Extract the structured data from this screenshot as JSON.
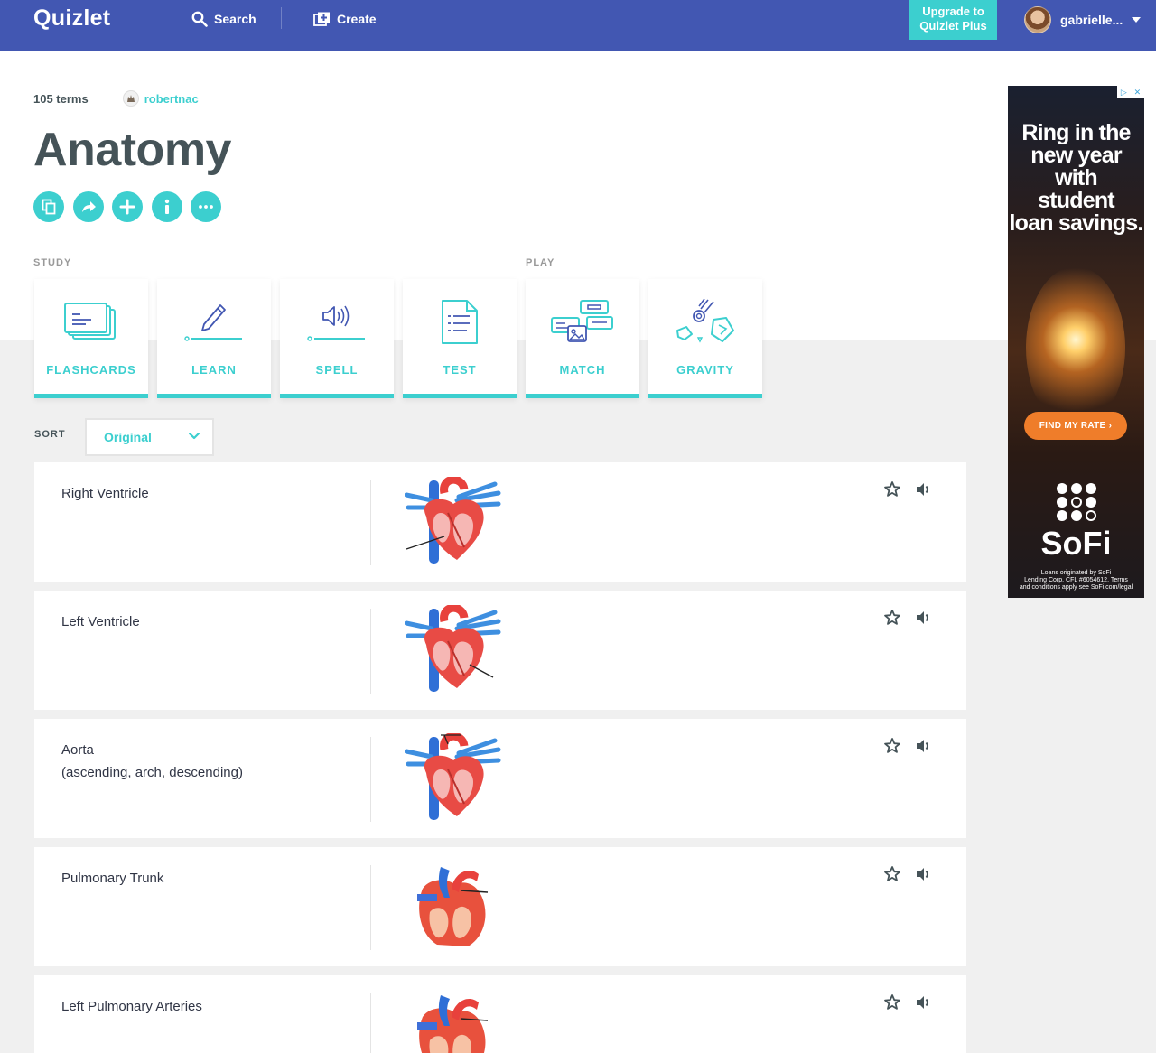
{
  "header": {
    "logo": "Quizlet",
    "search_label": "Search",
    "create_label": "Create",
    "upgrade_label": "Upgrade to Quizlet Plus",
    "username": "gabrielle..."
  },
  "set": {
    "term_count": "105 terms",
    "author": "robertnac",
    "title": "Anatomy",
    "actions": [
      {
        "icon": "copy-icon"
      },
      {
        "icon": "share-icon"
      },
      {
        "icon": "add-icon"
      },
      {
        "icon": "info-icon"
      },
      {
        "icon": "more-icon"
      }
    ]
  },
  "modes": {
    "study_label": "STUDY",
    "play_label": "PLAY",
    "items": [
      {
        "label": "FLASHCARDS",
        "icon": "flashcards-icon"
      },
      {
        "label": "LEARN",
        "icon": "learn-icon"
      },
      {
        "label": "SPELL",
        "icon": "spell-icon"
      },
      {
        "label": "TEST",
        "icon": "test-icon"
      },
      {
        "label": "MATCH",
        "icon": "match-icon"
      },
      {
        "label": "GRAVITY",
        "icon": "gravity-icon"
      }
    ]
  },
  "sort": {
    "label": "SORT",
    "selected": "Original"
  },
  "terms": [
    {
      "term": "Right Ventricle",
      "term2": ""
    },
    {
      "term": "Left Ventricle",
      "term2": ""
    },
    {
      "term": "Aorta",
      "term2": "(ascending, arch, descending)"
    },
    {
      "term": "Pulmonary Trunk",
      "term2": ""
    },
    {
      "term": "Left Pulmonary Arteries",
      "term2": ""
    }
  ],
  "ad": {
    "headline_1": "Ring in the",
    "headline_2": "new year",
    "headline_3": "with",
    "headline_4": "student",
    "headline_5": "loan savings.",
    "cta": "FIND MY RATE",
    "brand": "SoFi",
    "fine_1": "Loans originated by SoFi",
    "fine_2": "Lending Corp. CFL #6054612. Terms",
    "fine_3": "and conditions apply see SoFi.com/legal"
  },
  "colors": {
    "header_bg": "#4257b2",
    "accent": "#3ccfcf",
    "text": "#455358",
    "band": "#f0f0f0"
  }
}
